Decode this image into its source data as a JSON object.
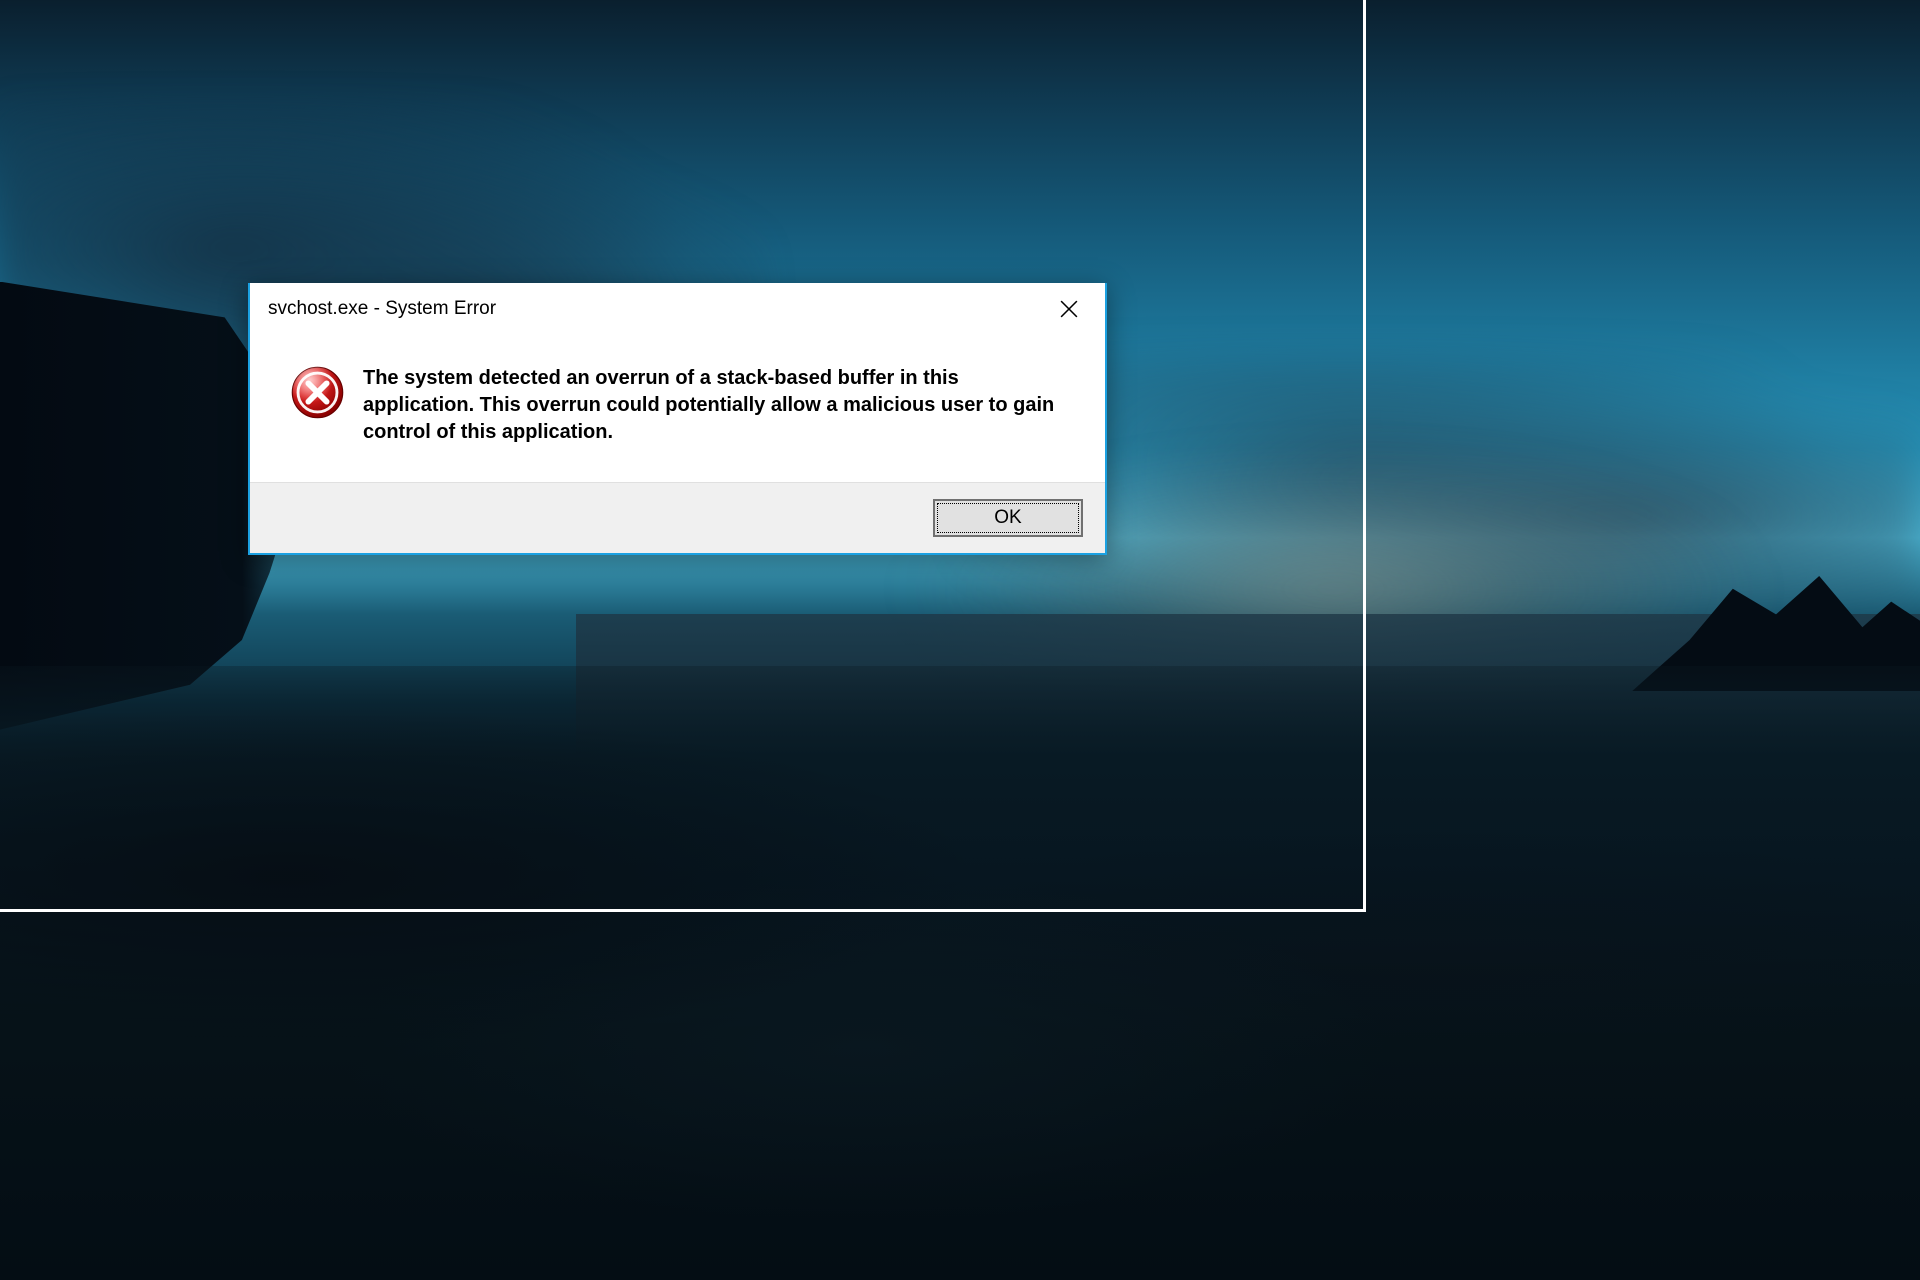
{
  "dialog": {
    "title": "svchost.exe - System Error",
    "message": "The system detected an overrun of a stack-based buffer in this application. This overrun could potentially allow a malicious user to gain control of this application.",
    "ok_label": "OK"
  }
}
